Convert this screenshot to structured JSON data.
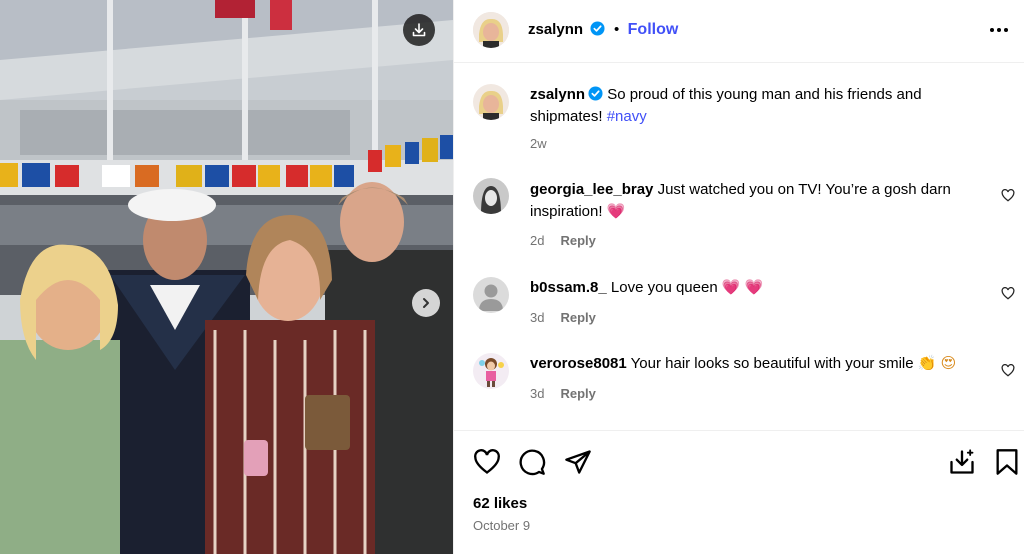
{
  "post": {
    "username": "zsalynn",
    "follow_label": "Follow",
    "caption_text": "So proud of this young man and his friends and shipmates!",
    "caption_hashtag": "#navy",
    "caption_age": "2w",
    "likes": "62 likes",
    "date": "October 9"
  },
  "comments": [
    {
      "username": "georgia_lee_bray",
      "text": "Just watched you on TV! You’re a gosh darn inspiration!",
      "emoji": "💗",
      "age": "2d",
      "reply": "Reply"
    },
    {
      "username": "b0ssam.8_",
      "text": "Love you queen",
      "emoji": "💗 💗",
      "age": "3d",
      "reply": "Reply"
    },
    {
      "username": "verorose8081",
      "text": "Your hair looks so beautiful with your smile",
      "emoji": "👏 😍",
      "age": "3d",
      "reply": "Reply"
    }
  ],
  "colors": {
    "link": "#4150f7",
    "verified": "#0095f6",
    "muted": "#737373"
  }
}
